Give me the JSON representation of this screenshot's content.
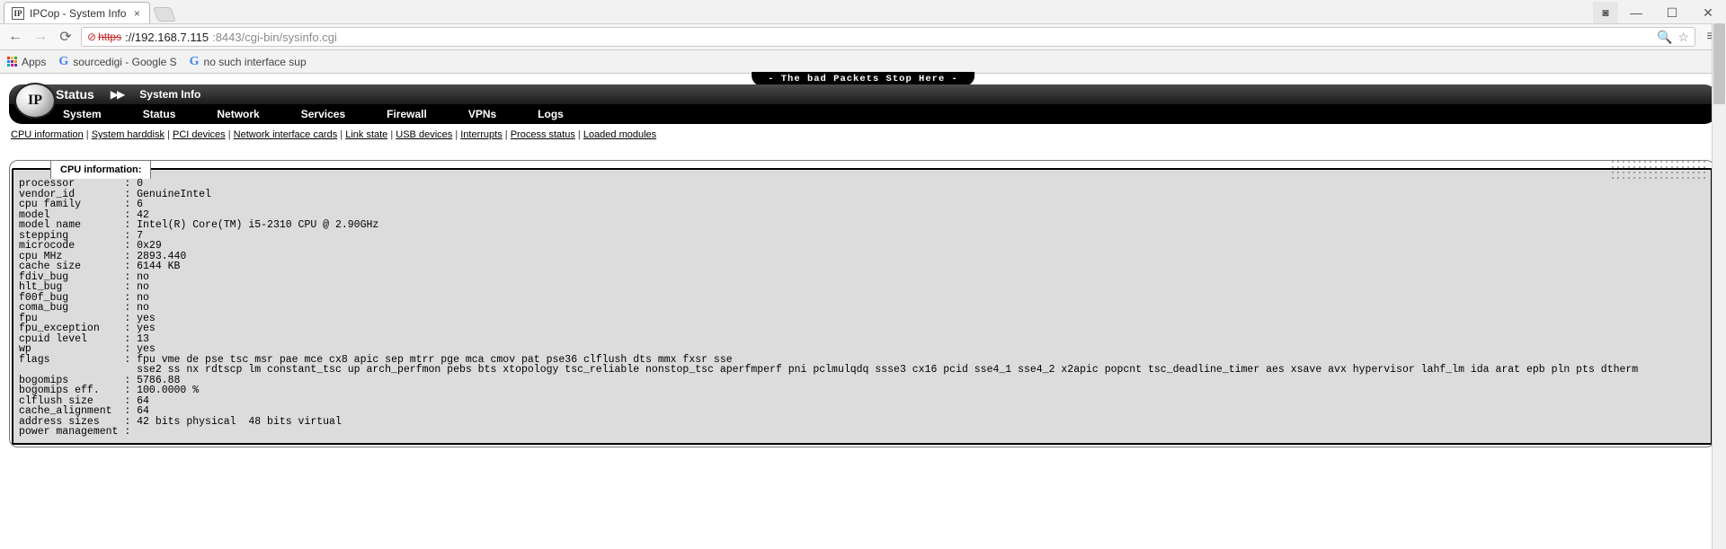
{
  "browser": {
    "tab_title": "IPCop - System Info",
    "url_protocol_struck": "https",
    "url_host": "://192.168.7.115",
    "url_port_path": ":8443/cgi-bin/sysinfo.cgi",
    "bookmarks": {
      "apps": "Apps",
      "bm1": "sourcedigi - Google S",
      "bm2": "no such interface sup"
    }
  },
  "page": {
    "slogan": "- The bad Packets Stop Here -",
    "header_title": "Status",
    "header_sub": "System Info",
    "menu": [
      "System",
      "Status",
      "Network",
      "Services",
      "Firewall",
      "VPNs",
      "Logs"
    ],
    "anchors": [
      "CPU information",
      "System harddisk",
      "PCI devices",
      "Network interface cards",
      "Link state",
      "USB devices",
      "Interrupts",
      "Process status",
      "Loaded modules"
    ],
    "card_title": "CPU information:"
  },
  "cpu": {
    "processor": "0",
    "vendor_id": "GenuineIntel",
    "cpu_family": "6",
    "model": "42",
    "model_name": "Intel(R) Core(TM) i5-2310 CPU @ 2.90GHz",
    "stepping": "7",
    "microcode": "0x29",
    "cpu_mhz": "2893.440",
    "cache_size": "6144 KB",
    "fdiv_bug": "no",
    "hlt_bug": "no",
    "f00f_bug": "no",
    "coma_bug": "no",
    "fpu": "yes",
    "fpu_exception": "yes",
    "cpuid_level": "13",
    "wp": "yes",
    "flags_l1": "fpu vme de pse tsc msr pae mce cx8 apic sep mtrr pge mca cmov pat pse36 clflush dts mmx fxsr sse",
    "flags_l2": "sse2 ss nx rdtscp lm constant_tsc up arch_perfmon pebs bts xtopology tsc_reliable nonstop_tsc aperfmperf pni pclmulqdq ssse3 cx16 pcid sse4_1 sse4_2 x2apic popcnt tsc_deadline_timer aes xsave avx hypervisor lahf_lm ida arat epb pln pts dtherm",
    "bogomips": "5786.88",
    "bogomips_eff": "100.0000 %",
    "clflush_size": "64",
    "cache_alignment": "64",
    "address_sizes": "42 bits physical  48 bits virtual",
    "power_management": ""
  }
}
